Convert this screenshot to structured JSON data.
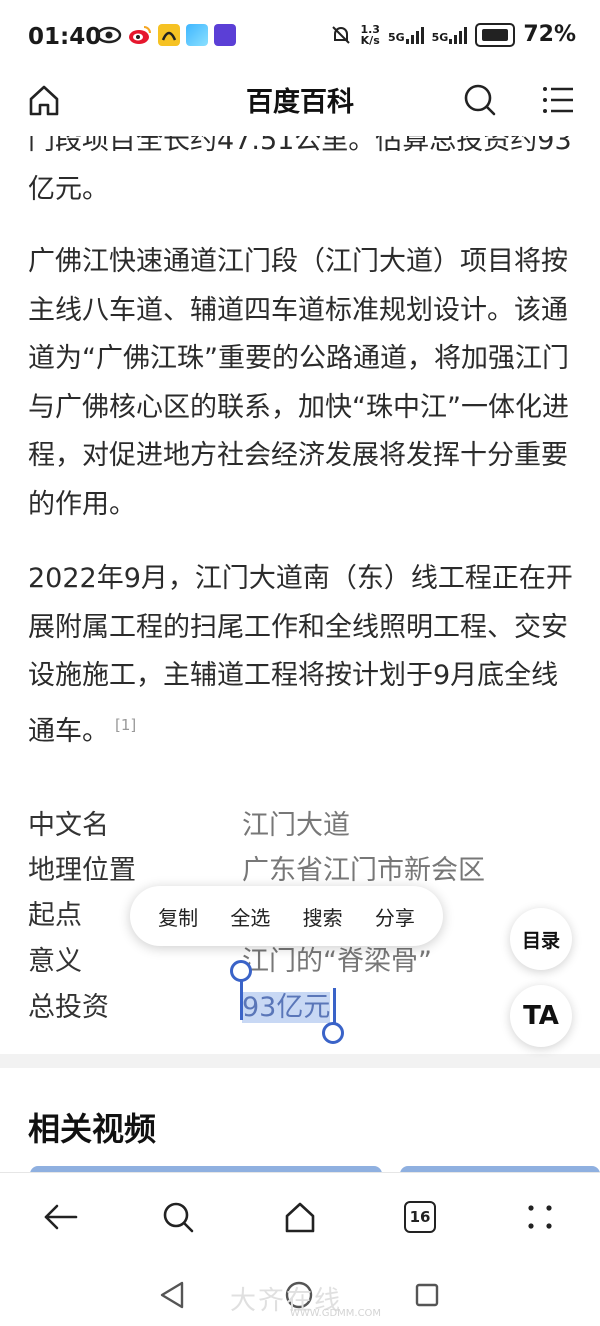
{
  "status_bar": {
    "time": "01:40",
    "net_speed_value": "1.3",
    "net_speed_unit": "K/s",
    "signal1": "5G",
    "signal2": "5G",
    "battery": "72%"
  },
  "header": {
    "title": "百度百科"
  },
  "article": {
    "paragraph_partial": "门段项目全长约47.51公里。估算总投资约93亿元。",
    "paragraph_2": "广佛江快速通道江门段（江门大道）项目将按主线八车道、辅道四车道标准规划设计。该通道为“广佛江珠”重要的公路通道，将加强江门与广佛核心区的联系，加快“珠中江”一体化进程，对促进地方社会经济发展将发挥十分重要的作用。",
    "paragraph_3": "2022年9月，江门大道南（东）线工程正在开展附属工程的扫尾工作和全线照明工程、交安设施施工，主辅道工程将按计划于9月底全线通车。",
    "ref_mark": "[1]"
  },
  "infobox": [
    {
      "label": "中文名",
      "value": "江门大道"
    },
    {
      "label": "地理位置",
      "value": "广东省江门市新会区"
    },
    {
      "label": "起点",
      "value": ""
    },
    {
      "label": "意义",
      "value": "江门的“脊梁骨”"
    },
    {
      "label": "总投资",
      "value": "93亿元"
    }
  ],
  "context_menu": {
    "copy": "复制",
    "select_all": "全选",
    "search": "搜索",
    "share": "分享"
  },
  "floating": {
    "toc": "目录",
    "font_size": "TA"
  },
  "related": {
    "title": "相关视频"
  },
  "bottom_nav": {
    "tab_count": "16"
  },
  "watermark": {
    "text": "大齐在线",
    "url": "WWW.GDMM.COM"
  },
  "colors": {
    "accent": "#3a63c8",
    "selection": "#c8d8f4"
  }
}
